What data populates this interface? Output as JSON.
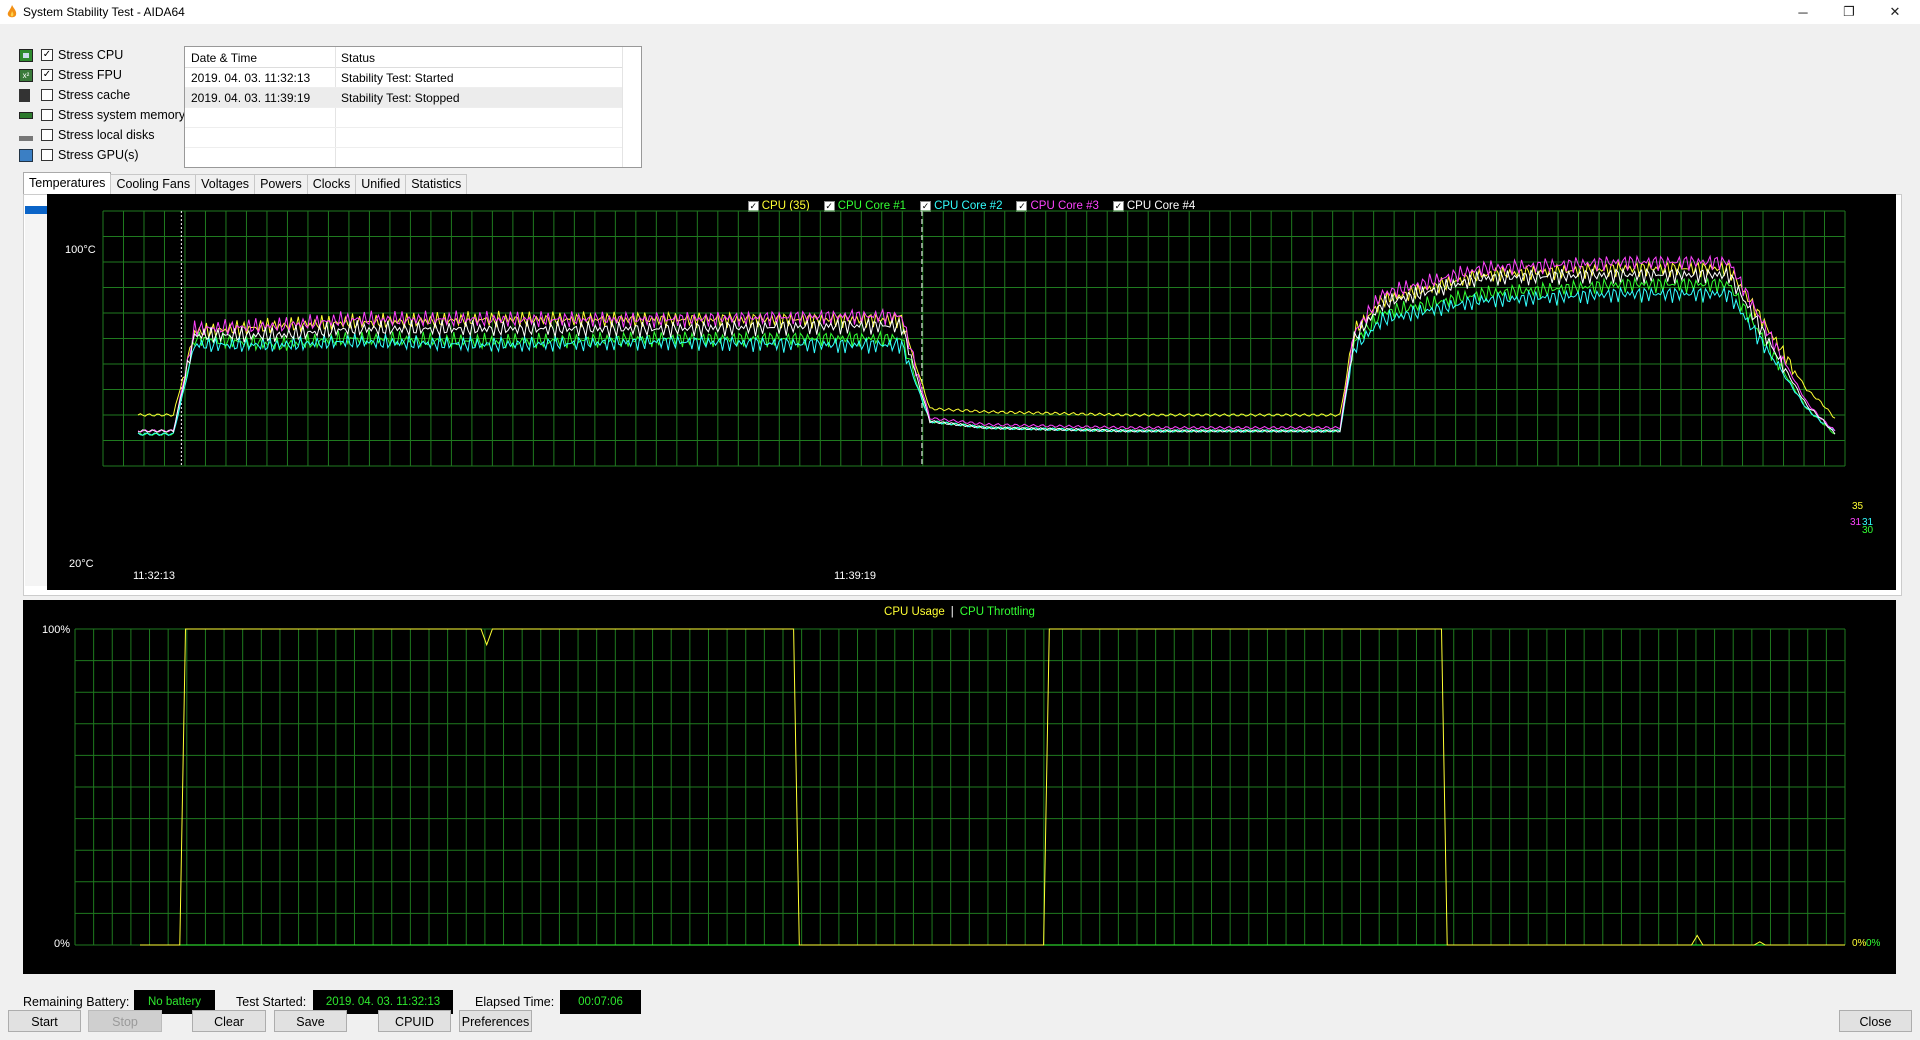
{
  "window": {
    "title": "System Stability Test - AIDA64",
    "minimize": "─",
    "maximize": "❐",
    "close": "✕"
  },
  "options": [
    {
      "label": "Stress CPU",
      "checked": true,
      "icon": "cpu-icon"
    },
    {
      "label": "Stress FPU",
      "checked": true,
      "icon": "fpu-icon"
    },
    {
      "label": "Stress cache",
      "checked": false,
      "icon": "cache-icon"
    },
    {
      "label": "Stress system memory",
      "checked": false,
      "icon": "memory-icon"
    },
    {
      "label": "Stress local disks",
      "checked": false,
      "icon": "disk-icon"
    },
    {
      "label": "Stress GPU(s)",
      "checked": false,
      "icon": "gpu-icon"
    }
  ],
  "log": {
    "columns": [
      "Date & Time",
      "Status"
    ],
    "rows": [
      {
        "datetime": "2019. 04. 03. 11:32:13",
        "status": "Stability Test: Started"
      },
      {
        "datetime": "2019. 04. 03. 11:39:19",
        "status": "Stability Test: Stopped"
      }
    ]
  },
  "tabs": [
    "Temperatures",
    "Cooling Fans",
    "Voltages",
    "Powers",
    "Clocks",
    "Unified",
    "Statistics"
  ],
  "active_tab": "Temperatures",
  "temp_chart": {
    "legend": [
      {
        "label": "CPU (35)",
        "color": "#ffff33"
      },
      {
        "label": "CPU Core #1",
        "color": "#33ff33"
      },
      {
        "label": "CPU Core #2",
        "color": "#33ffff"
      },
      {
        "label": "CPU Core #3",
        "color": "#ff44ff"
      },
      {
        "label": "CPU Core #4",
        "color": "#ffffff"
      }
    ],
    "ymax": "100°C",
    "ymin": "20°C",
    "markers": [
      "11:32:13",
      "11:39:19"
    ],
    "end_values": [
      {
        "text": "35",
        "color": "#ffff33"
      },
      {
        "text": "31",
        "color": "#ff44ff"
      },
      {
        "text": "31",
        "color": "#33ffff"
      },
      {
        "text": "30",
        "color": "#33ff33"
      }
    ]
  },
  "usage_chart": {
    "legend_usage": "CPU Usage",
    "legend_sep": "|",
    "legend_throttle": "CPU Throttling",
    "usage_color": "#ffff33",
    "throttle_color": "#33ff33",
    "ymax": "100%",
    "ymin": "0%",
    "end_usage": "0%",
    "end_throttle": "0%"
  },
  "status": {
    "battery_label": "Remaining Battery:",
    "battery_value": "No battery",
    "started_label": "Test Started:",
    "started_value": "2019. 04. 03. 11:32:13",
    "elapsed_label": "Elapsed Time:",
    "elapsed_value": "00:07:06"
  },
  "buttons": {
    "start": "Start",
    "stop": "Stop",
    "clear": "Clear",
    "save": "Save",
    "cpuid": "CPUID",
    "preferences": "Preferences",
    "close": "Close"
  },
  "chart_data": [
    {
      "type": "line",
      "title": "",
      "ylim": [
        20,
        100
      ],
      "ylabel": "",
      "x_unit": "samples",
      "x": [
        0,
        5,
        8,
        20,
        30,
        50,
        75,
        100,
        108,
        112,
        120,
        140,
        160,
        170,
        172,
        176,
        190,
        210,
        225,
        236,
        238,
        240
      ],
      "series": [
        {
          "name": "CPU (35)",
          "values": [
            36,
            36,
            62,
            64,
            65,
            66,
            66,
            66,
            66,
            38,
            37,
            36,
            36,
            36,
            62,
            72,
            80,
            82,
            82,
            44,
            40,
            35
          ]
        },
        {
          "name": "CPU Core #1",
          "values": [
            30,
            30,
            60,
            58,
            60,
            59,
            60,
            60,
            60,
            34,
            32,
            31,
            31,
            31,
            59,
            68,
            74,
            77,
            77,
            38,
            34,
            30
          ]
        },
        {
          "name": "CPU Core #2",
          "values": [
            30,
            30,
            58,
            58,
            59,
            58,
            59,
            58,
            58,
            34,
            32,
            31,
            31,
            31,
            57,
            66,
            72,
            74,
            74,
            38,
            34,
            31
          ]
        },
        {
          "name": "CPU Core #3",
          "values": [
            31,
            31,
            63,
            64,
            66,
            66,
            66,
            67,
            67,
            35,
            33,
            32,
            32,
            32,
            62,
            74,
            82,
            84,
            84,
            40,
            35,
            31
          ]
        },
        {
          "name": "CPU Core #4",
          "values": [
            31,
            31,
            61,
            61,
            63,
            63,
            63,
            64,
            64,
            34,
            32,
            31,
            31,
            31,
            60,
            71,
            79,
            80,
            80,
            39,
            35,
            30
          ]
        }
      ]
    },
    {
      "type": "line",
      "title": "",
      "ylim": [
        0,
        100
      ],
      "x": [
        0,
        7,
        8,
        60,
        61,
        62,
        115,
        116,
        159,
        160,
        161,
        229,
        230,
        273,
        274,
        275,
        284,
        285,
        286,
        300
      ],
      "series": [
        {
          "name": "CPU Usage",
          "values": [
            0,
            0,
            100,
            100,
            95,
            100,
            100,
            0,
            0,
            100,
            100,
            100,
            0,
            0,
            3,
            0,
            0,
            1,
            0,
            0
          ]
        },
        {
          "name": "CPU Throttling",
          "values": [
            0,
            0,
            0,
            0,
            0,
            0,
            0,
            0,
            0,
            0,
            0,
            0,
            0,
            0,
            0,
            0,
            0,
            0,
            0,
            0
          ]
        }
      ]
    }
  ]
}
